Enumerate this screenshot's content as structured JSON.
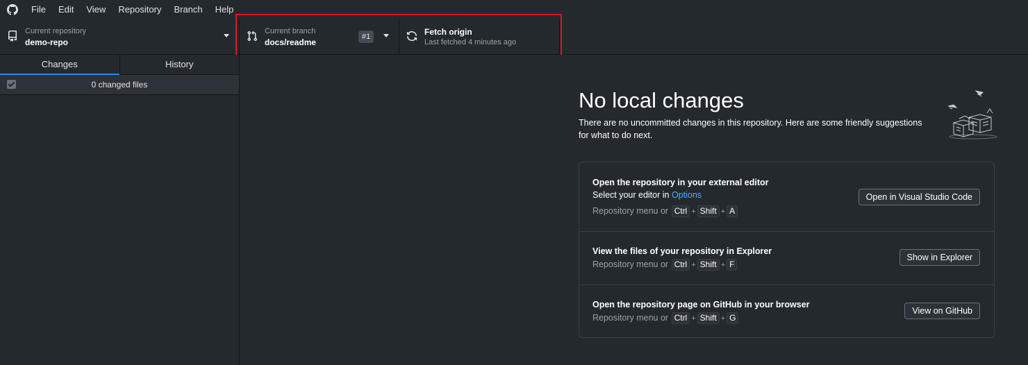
{
  "menubar": {
    "logo": "github-logo",
    "items": [
      "File",
      "Edit",
      "View",
      "Repository",
      "Branch",
      "Help"
    ]
  },
  "toolbar": {
    "repo": {
      "label": "Current repository",
      "value": "demo-repo"
    },
    "branch": {
      "label": "Current branch",
      "value": "docs/readme",
      "pr_badge": "#1"
    },
    "fetch": {
      "title": "Fetch origin",
      "subtitle": "Last fetched 4 minutes ago"
    }
  },
  "sidebar": {
    "tabs": [
      "Changes",
      "History"
    ],
    "active_tab": "Changes",
    "changes_count_label": "0 changed files"
  },
  "main": {
    "title": "No local changes",
    "description": "There are no uncommitted changes in this repository. Here are some friendly suggestions for what to do next.",
    "actions": [
      {
        "title": "Open the repository in your external editor",
        "desc_prefix": "Select your editor in ",
        "desc_link": "Options",
        "shortcut_prefix": "Repository menu or",
        "keys": [
          "Ctrl",
          "Shift",
          "A"
        ],
        "button": "Open in Visual Studio Code"
      },
      {
        "title": "View the files of your repository in Explorer",
        "shortcut_prefix": "Repository menu or",
        "keys": [
          "Ctrl",
          "Shift",
          "F"
        ],
        "button": "Show in Explorer"
      },
      {
        "title": "Open the repository page on GitHub in your browser",
        "shortcut_prefix": "Repository menu or",
        "keys": [
          "Ctrl",
          "Shift",
          "G"
        ],
        "button": "View on GitHub"
      }
    ]
  },
  "colors": {
    "background": "#24292e",
    "accent_blue": "#2f81f7",
    "link": "#58a6ff",
    "highlight_red": "#e0151d"
  }
}
